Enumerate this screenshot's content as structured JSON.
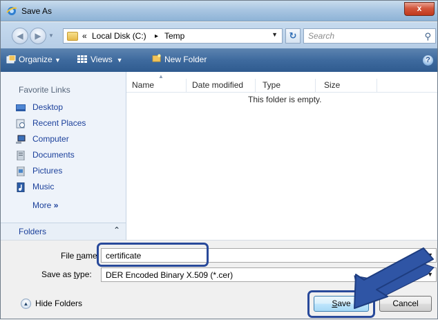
{
  "window": {
    "title": "Save As",
    "close_label": "x"
  },
  "address": {
    "overflow": "«",
    "crumbs": [
      "Local Disk (C:)",
      "Temp"
    ],
    "separator": "▸",
    "search_placeholder": "Search"
  },
  "toolbar": {
    "organize": "Organize",
    "views": "Views",
    "new_folder": "New Folder"
  },
  "nav": {
    "favorites_title": "Favorite Links",
    "items": [
      {
        "label": "Desktop",
        "icon": "desktop-icon"
      },
      {
        "label": "Recent Places",
        "icon": "recent-places-icon"
      },
      {
        "label": "Computer",
        "icon": "computer-icon"
      },
      {
        "label": "Documents",
        "icon": "documents-icon"
      },
      {
        "label": "Pictures",
        "icon": "pictures-icon"
      },
      {
        "label": "Music",
        "icon": "music-icon"
      }
    ],
    "more": "More",
    "folders": "Folders"
  },
  "filelist": {
    "columns": [
      "Name",
      "Date modified",
      "Type",
      "Size"
    ],
    "empty_message": "This folder is empty."
  },
  "form": {
    "filename_label_pre": "File ",
    "filename_label_u": "n",
    "filename_label_post": "ame:",
    "filename_value": "certificate",
    "type_label_pre": "Save as ",
    "type_label_u": "t",
    "type_label_post": "ype:",
    "type_value": "DER Encoded Binary X.509 (*.cer)",
    "hide_folders": "Hide Folders",
    "save_u": "S",
    "save_rest": "ave",
    "cancel": "Cancel"
  },
  "colors": {
    "highlight": "#28499a",
    "toolbar": "#3e6a9e",
    "link": "#1a3f9a"
  }
}
